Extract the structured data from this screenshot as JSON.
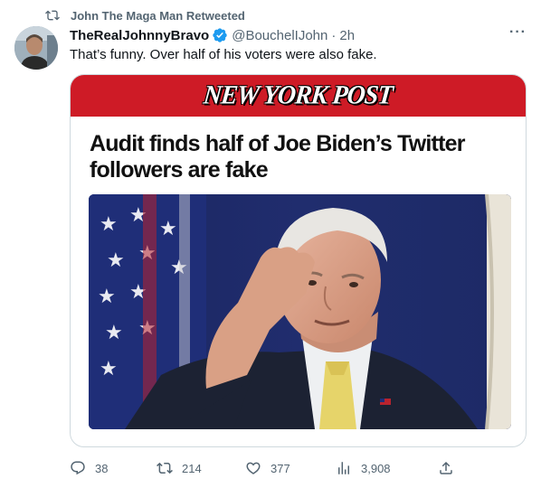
{
  "retweet": {
    "text": "John The Maga Man Retweeted"
  },
  "tweet": {
    "display_name": "TheRealJohnnyBravo",
    "handle": "@BouchelIJohn",
    "dot": "·",
    "time": "2h",
    "text": "That’s funny. Over half of his voters were also fake.",
    "more": "···"
  },
  "card": {
    "masthead": "NEW YORK POST",
    "headline": "Audit finds half of Joe Biden’s Twitter followers are fake"
  },
  "actions": {
    "replies": "38",
    "retweets": "214",
    "likes": "377",
    "views": "3,908"
  },
  "colors": {
    "brand_blue": "#1d9bf0",
    "nyp_red": "#ce1b26",
    "secondary_text": "#536471"
  }
}
